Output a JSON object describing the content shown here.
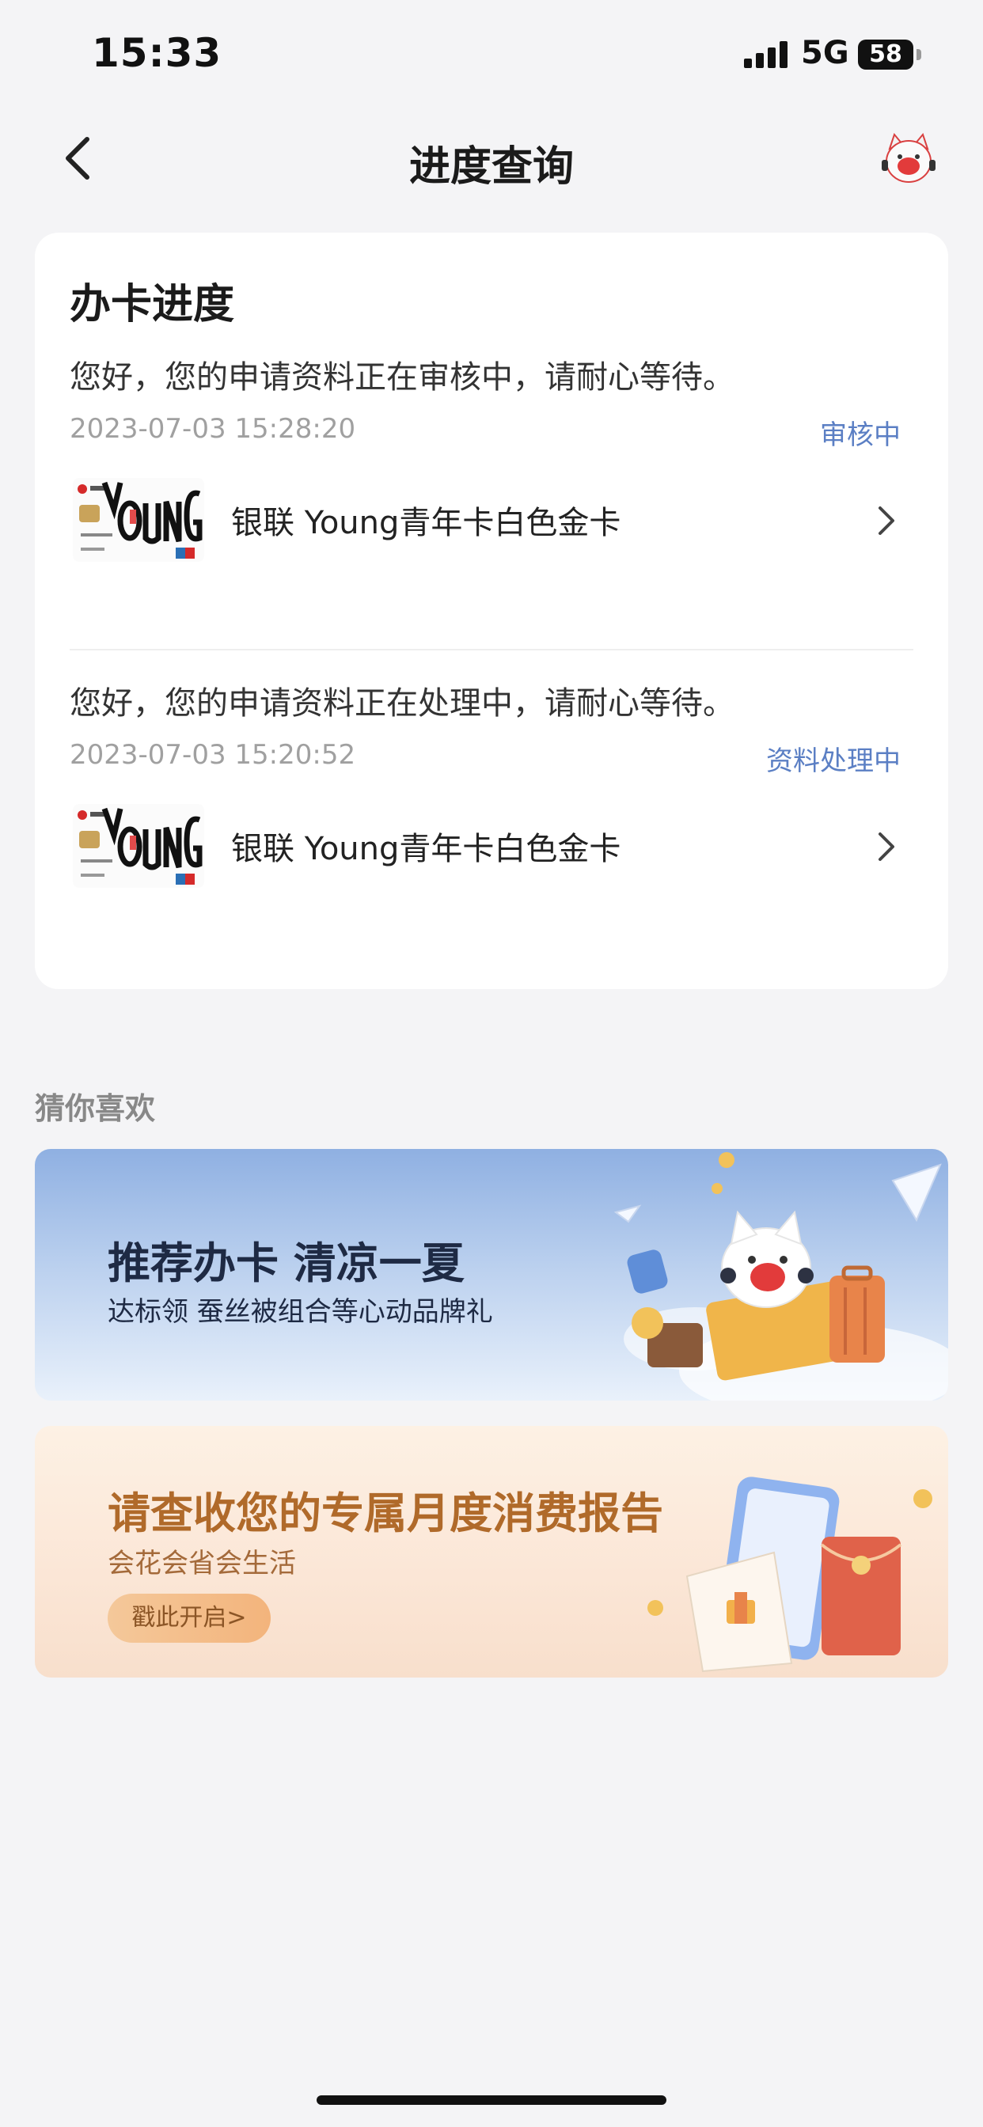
{
  "status_bar": {
    "time": "15:33",
    "network": "5G",
    "battery": "58"
  },
  "nav": {
    "title": "进度查询"
  },
  "progress_card": {
    "title": "办卡进度",
    "records": [
      {
        "message": "您好，您的申请资料正在审核中，请耐心等待。",
        "time": "2023-07-03 15:28:20",
        "status": "审核中",
        "product": "银联 Young青年卡白色金卡"
      },
      {
        "message": "您好，您的申请资料正在处理中，请耐心等待。",
        "time": "2023-07-03 15:20:52",
        "status": "资料处理中",
        "product": "银联 Young青年卡白色金卡"
      }
    ]
  },
  "recommend": {
    "section_title": "猜你喜欢",
    "banners": [
      {
        "title": "推荐办卡 清凉一夏",
        "subtitle": "达标领 蚕丝被组合等心动品牌礼"
      },
      {
        "title": "请查收您的专属月度消费报告",
        "subtitle": "会花会省会生活",
        "button": "戳此开启>"
      }
    ]
  },
  "colors": {
    "accent": "#5b7fc4",
    "background": "#f4f4f6",
    "banner2_title": "#b06a2a"
  },
  "icons": [
    "back-arrow-icon",
    "mascot-avatar-icon",
    "chevron-right-icon",
    "signal-icon",
    "battery-icon"
  ]
}
